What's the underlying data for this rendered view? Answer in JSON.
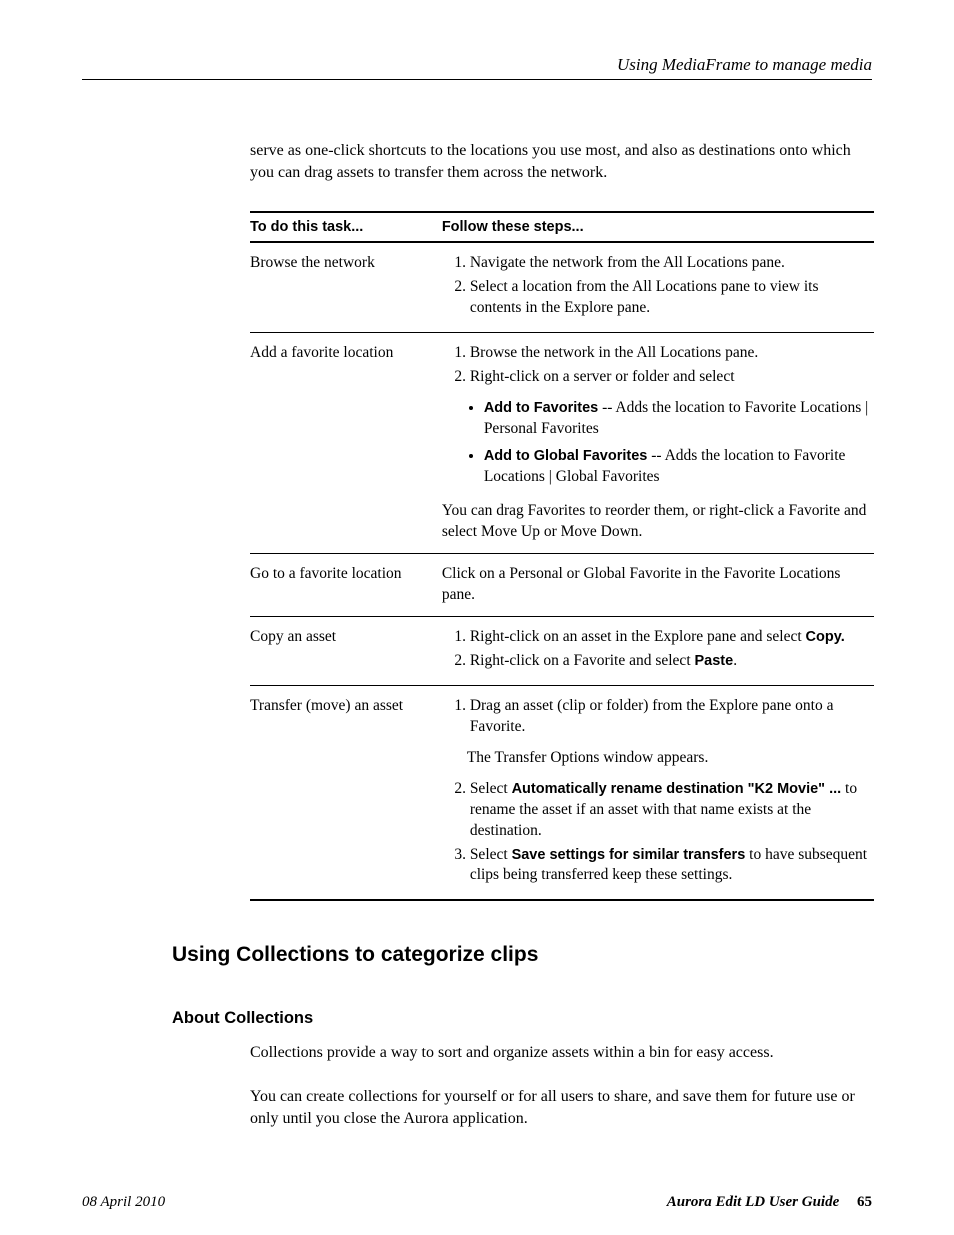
{
  "header": {
    "right": "Using MediaFrame to manage media"
  },
  "intro_text": "serve as one-click shortcuts to the locations you use most, and also as destinations onto which you can drag assets to transfer them across the network.",
  "table": {
    "header_task": "To do this task...",
    "header_steps": "Follow these steps...",
    "rows": {
      "browse_network": {
        "task": "Browse the network",
        "step1": "Navigate the network from the All Locations pane.",
        "step2": "Select a location from the All Locations pane to view its contents in the Explore pane."
      },
      "add_fav": {
        "task": "Add a favorite location",
        "step1": "Browse the network in the All Locations pane.",
        "step2": "Right-click on a server or folder and select",
        "b1_bold": "Add to Favorites",
        "b1_rest": " -- Adds the location to Favorite Locations | Personal Favorites",
        "b2_bold": "Add to Global Favorites",
        "b2_rest": " -- Adds the location to Favorite Locations | Global Favorites",
        "after": "You can drag Favorites to reorder them, or right-click a Favorite and select Move Up or Move Down."
      },
      "go_fav": {
        "task": "Go to a favorite location",
        "text": "Click on a Personal or Global Favorite in the Favorite Locations pane."
      },
      "copy_asset": {
        "task": "Copy an asset",
        "step1_pre": "Right-click on an asset in the Explore pane and select ",
        "step1_bold": "Copy.",
        "step2_pre": "Right-click on a Favorite and select ",
        "step2_bold": "Paste",
        "step2_post": "."
      },
      "transfer": {
        "task": "Transfer (move) an asset",
        "step1": "Drag an asset (clip or folder) from the Explore pane onto a Favorite.",
        "mid": "The Transfer Options window appears.",
        "step2_pre": "Select ",
        "step2_bold": "Automatically rename destination \"K2 Movie\" ...",
        "step2_post": " to rename the asset if an asset with that name exists at the destination.",
        "step3_pre": "Select ",
        "step3_bold": "Save settings for similar transfers",
        "step3_post": " to have subsequent clips being transferred keep these settings."
      }
    }
  },
  "section2": {
    "heading": "Using Collections to categorize clips",
    "sub_heading": "About Collections",
    "p1": "Collections provide a way to sort and organize assets within a bin for easy access.",
    "p2": "You can create collections for yourself or for all users to share, and save them for future use or only until you close the Aurora application."
  },
  "footer": {
    "date": "08 April 2010",
    "doc": "Aurora Edit LD User Guide",
    "page": "65"
  }
}
